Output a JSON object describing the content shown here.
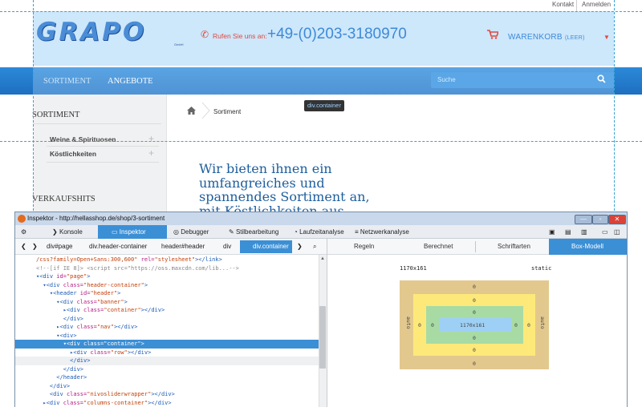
{
  "site": {
    "top_links": [
      "Kontakt",
      "Anmelden"
    ],
    "logo_text": "GRAPO",
    "logo_sub": "GmbH",
    "phone_label": "Rufen Sie uns an:",
    "phone_number": "+49-(0)203-3180970",
    "cart_label": "WARENKORB",
    "cart_status": "(LEER)",
    "nav": [
      "SORTIMENT",
      "ANGEBOTE"
    ],
    "search_placeholder": "Suche",
    "sidebar_title": "SORTIMENT",
    "sidebar_items": [
      "Weine & Spirituosen",
      "Köstlichkeiten"
    ],
    "sidebar_title2": "VERKAUFSHITS",
    "breadcrumb": "Sortiment",
    "tooltip": "div.container",
    "headline": "Wir bieten ihnen ein umfangreiches und spannendes Sortiment an, mit Köstlichkeiten aus aller"
  },
  "devtools": {
    "title": "Inspektor - http://hellasshop.de/shop/3-sortiment",
    "tabs": [
      "Konsole",
      "Inspektor",
      "Debugger",
      "Stilbearbeitung",
      "Laufzeitanalyse",
      "Netzwerkanalyse"
    ],
    "breadcrumbs": [
      "div#page",
      "div.header-container",
      "header#header",
      "div",
      "div.container"
    ],
    "right_tabs": [
      "Regeln",
      "Berechnet",
      "Schriftarten",
      "Box-Modell"
    ],
    "box": {
      "size": "1170x161",
      "position": "static",
      "inner": "1170x161",
      "margin": "0",
      "border": "0",
      "padding": "0",
      "auto_label": "auto"
    },
    "code_lines": [
      {
        "segs": [
          {
            "t": "/css?family=Open+Sans:300,600\"",
            "c": "av"
          },
          {
            "t": " rel=",
            "c": "at"
          },
          {
            "t": "\"stylesheet\"",
            "c": "av"
          },
          {
            "t": "></link>",
            "c": "tg"
          }
        ]
      },
      {
        "segs": [
          {
            "t": "<!--[if IE 8]> <script src=\"https://oss.maxcdn.com/lib...-->",
            "c": "cm"
          }
        ]
      },
      {
        "segs": [
          {
            "t": "▾<div ",
            "c": "tg"
          },
          {
            "t": "id=",
            "c": "at"
          },
          {
            "t": "\"page\"",
            "c": "av"
          },
          {
            "t": ">",
            "c": "tg"
          }
        ]
      },
      {
        "segs": [
          {
            "t": "  ▾<div ",
            "c": "tg"
          },
          {
            "t": "class=",
            "c": "at"
          },
          {
            "t": "\"header-container\"",
            "c": "av"
          },
          {
            "t": ">",
            "c": "tg"
          }
        ]
      },
      {
        "segs": [
          {
            "t": "    ▾<header ",
            "c": "tg"
          },
          {
            "t": "id=",
            "c": "at"
          },
          {
            "t": "\"header\"",
            "c": "av"
          },
          {
            "t": ">",
            "c": "tg"
          }
        ]
      },
      {
        "segs": [
          {
            "t": "      ▾<div ",
            "c": "tg"
          },
          {
            "t": "class=",
            "c": "at"
          },
          {
            "t": "\"banner\"",
            "c": "av"
          },
          {
            "t": ">",
            "c": "tg"
          }
        ]
      },
      {
        "segs": [
          {
            "t": "        ▸<div ",
            "c": "tg"
          },
          {
            "t": "class=",
            "c": "at"
          },
          {
            "t": "\"container\"",
            "c": "av"
          },
          {
            "t": "></div>",
            "c": "tg"
          }
        ]
      },
      {
        "segs": [
          {
            "t": "        </div>",
            "c": "tg"
          }
        ]
      },
      {
        "segs": [
          {
            "t": "      ▸<div ",
            "c": "tg"
          },
          {
            "t": "class=",
            "c": "at"
          },
          {
            "t": "\"nav\"",
            "c": "av"
          },
          {
            "t": "></div>",
            "c": "tg"
          }
        ]
      },
      {
        "segs": [
          {
            "t": "      ▾<div>",
            "c": "tg"
          }
        ]
      },
      {
        "segs": [
          {
            "t": "        ▾<div class=\"container\">",
            "c": "sel"
          }
        ],
        "selected": true
      },
      {
        "segs": [
          {
            "t": "          ▸<div ",
            "c": "tg"
          },
          {
            "t": "class=",
            "c": "at"
          },
          {
            "t": "\"row\"",
            "c": "av"
          },
          {
            "t": "></div>",
            "c": "tg"
          }
        ]
      },
      {
        "segs": [
          {
            "t": "          </div>",
            "c": "tg"
          }
        ],
        "hover": true
      },
      {
        "segs": [
          {
            "t": "        </div>",
            "c": "tg"
          }
        ]
      },
      {
        "segs": [
          {
            "t": "      </header>",
            "c": "tg"
          }
        ]
      },
      {
        "segs": [
          {
            "t": "    </div>",
            "c": "tg"
          }
        ]
      },
      {
        "segs": [
          {
            "t": "    <div ",
            "c": "tg"
          },
          {
            "t": "class=",
            "c": "at"
          },
          {
            "t": "\"nivosliderwrapper\"",
            "c": "av"
          },
          {
            "t": "></div>",
            "c": "tg"
          }
        ]
      },
      {
        "segs": [
          {
            "t": "  ▸<div ",
            "c": "tg"
          },
          {
            "t": "class=",
            "c": "at"
          },
          {
            "t": "\"columns-container\"",
            "c": "av"
          },
          {
            "t": "></div>",
            "c": "tg"
          }
        ]
      }
    ]
  }
}
